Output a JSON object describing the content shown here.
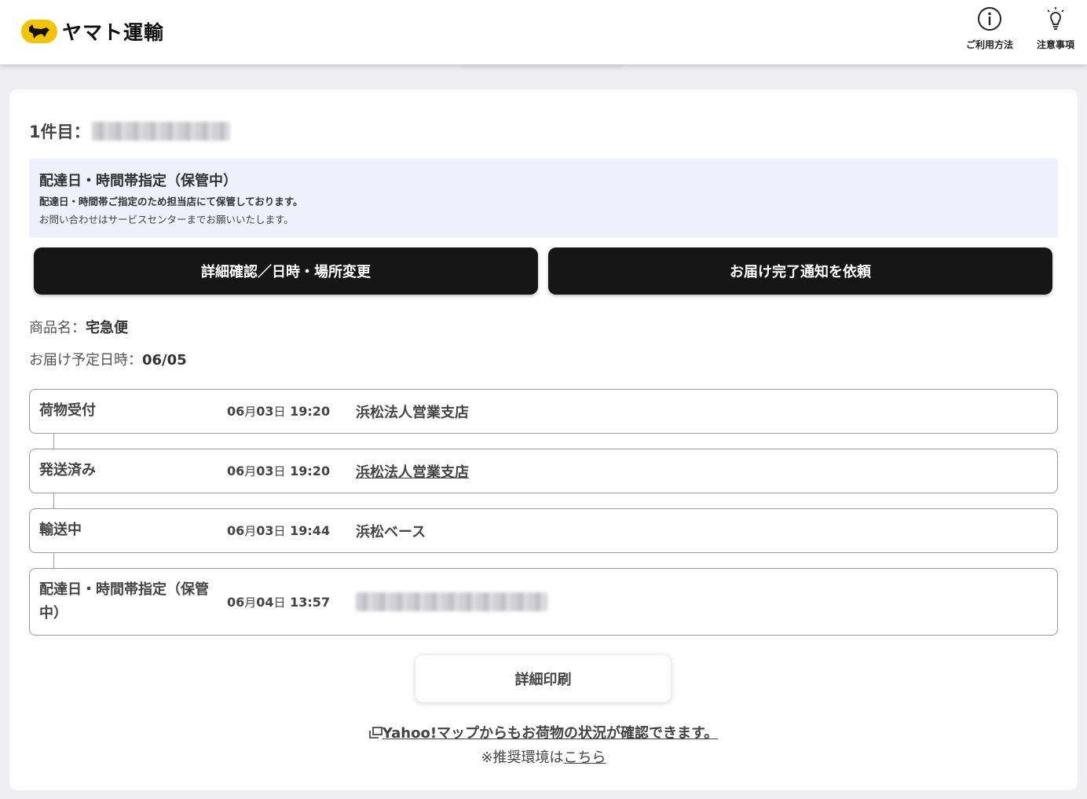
{
  "header": {
    "brand": "ヤマト運輸",
    "usage_label": "ご利用方法",
    "notes_label": "注意事項",
    "brand_color": "#f5c400"
  },
  "shipment": {
    "count_label": "1件目：",
    "notice": {
      "title": "配達日・時間帯指定（保管中）",
      "line1": "配達日・時間帯ご指定のため担当店にて保管しております。",
      "line2": "お問い合わせはサービスセンターまでお願いいたします。"
    },
    "buttons": {
      "detail": "詳細確認／日時・場所変更",
      "notify": "お届け完了通知を依頼"
    },
    "product_label": "商品名：",
    "product_value": "宅急便",
    "date_label": "お届け予定日時：",
    "date_value": "06/05",
    "timeline": [
      {
        "status": "荷物受付",
        "month": "06",
        "day": "03",
        "time": "19:20",
        "place": "浜松法人営業支店"
      },
      {
        "status": "発送済み",
        "month": "06",
        "day": "03",
        "time": "19:20",
        "place": "浜松法人営業支店"
      },
      {
        "status": "輸送中",
        "month": "06",
        "day": "03",
        "time": "19:44",
        "place": "浜松ベース"
      },
      {
        "status": "配達日・時間帯指定（保管中）",
        "month": "06",
        "day": "04",
        "time": "13:57",
        "place": ""
      }
    ],
    "date_units": {
      "month": "月",
      "day": "日"
    },
    "print_label": "詳細印刷",
    "yahoo_text": "Yahoo!マップからもお荷物の状況が確認できます。",
    "recommend_prefix": "※推奨環境は",
    "recommend_link": "こちら"
  }
}
